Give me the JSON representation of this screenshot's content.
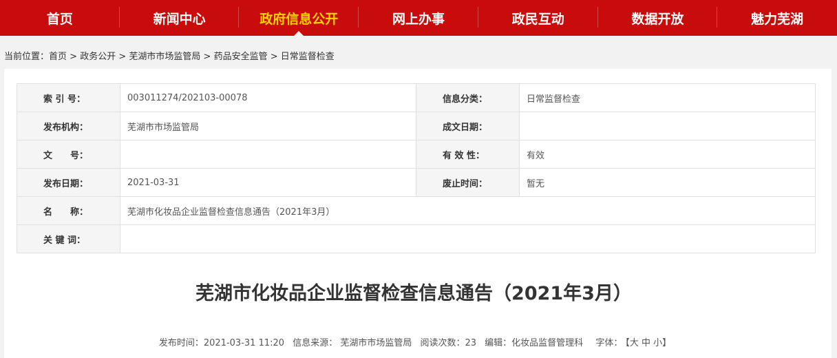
{
  "nav": {
    "items": [
      {
        "label": "首页"
      },
      {
        "label": "新闻中心"
      },
      {
        "label": "政府信息公开"
      },
      {
        "label": "网上办事"
      },
      {
        "label": "政民互动"
      },
      {
        "label": "数据开放"
      },
      {
        "label": "魅力芜湖"
      }
    ],
    "active_index": 2
  },
  "breadcrumb": {
    "prefix": "当前位置：",
    "items": [
      "首页",
      "政务公开",
      "芜湖市市场监管局",
      "药品安全监管",
      "日常监督检查"
    ],
    "separator": " > "
  },
  "meta": {
    "index_label": "索 引 号：",
    "index_value": "003011274/202103-00078",
    "category_label": "信息分类：",
    "category_value": "日常监督检查",
    "org_label": "发布机构：",
    "org_value": "芜湖市市场监管局",
    "created_label": "成文日期：",
    "created_value": "",
    "docno_label": "文　　号：",
    "docno_value": "",
    "validity_label": "有 效 性：",
    "validity_value": "有效",
    "pubdate_label": "发布日期：",
    "pubdate_value": "2021-03-31",
    "expire_label": "废止时间：",
    "expire_value": "暂无",
    "name_label": "名　　称：",
    "name_value": "芜湖市化妆品企业监督检查信息通告（2021年3月）",
    "keywords_label": "关 键 词：",
    "keywords_value": ""
  },
  "article": {
    "title": "芜湖市化妆品企业监督检查信息通告（2021年3月）",
    "publish_time": "发布时间：2021-03-31 11:20",
    "source": "信息来源： 芜湖市市场监管局",
    "views": "阅读次数：23",
    "editor": "编辑：化妆品监督管理科",
    "font_label": "字体：",
    "font_sizes": "【大 中 小】"
  },
  "colors": {
    "nav_bg": "#c80b0b",
    "nav_active": "#ffd200"
  }
}
